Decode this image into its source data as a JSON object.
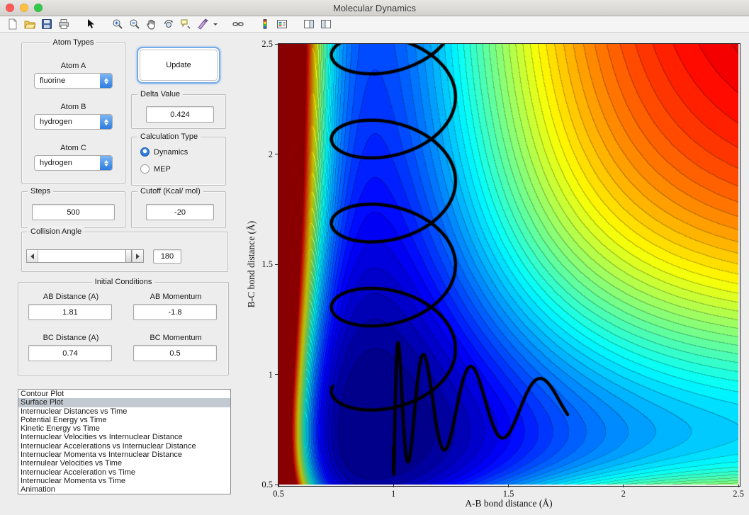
{
  "window": {
    "title": "Molecular Dynamics"
  },
  "colors": {
    "traffic_red": "#fc5b57",
    "traffic_yellow": "#fdbe41",
    "traffic_green": "#34c84a",
    "accent_blue": "#2e7ce0",
    "list_selection_bg": "#c2c9d1",
    "figure_bg": "#ededed"
  },
  "toolbar": {
    "groups": [
      [
        "new-figure",
        "open-file",
        "save-figure",
        "print-figure"
      ],
      [
        "edit-plot-pointer"
      ],
      [
        "zoom-in",
        "zoom-out",
        "pan",
        "rotate-3d",
        "data-cursor",
        "brush",
        "brush-dropdown"
      ],
      [
        "link-plot"
      ],
      [
        "insert-colorbar",
        "insert-legend"
      ],
      [
        "hide-plot-tools",
        "show-plot-tools"
      ]
    ]
  },
  "controls": {
    "atom_types": {
      "title": "Atom Types",
      "fields": [
        {
          "label": "Atom A",
          "value": "fluorine"
        },
        {
          "label": "Atom B",
          "value": "hydrogen"
        },
        {
          "label": "Atom C",
          "value": "hydrogen"
        }
      ]
    },
    "update_label": "Update",
    "delta": {
      "title": "Delta Value",
      "value": "0.424"
    },
    "calculation_type": {
      "title": "Calculation Type",
      "options": [
        {
          "label": "Dynamics",
          "selected": true
        },
        {
          "label": "MEP",
          "selected": false
        }
      ]
    },
    "steps": {
      "title": "Steps",
      "value": "500"
    },
    "cutoff": {
      "title": "Cutoff (Kcal/ mol)",
      "value": "-20"
    },
    "collision_angle": {
      "title": "Collision Angle",
      "value": "180"
    },
    "initial_conditions": {
      "title": "Initial Conditions",
      "fields": [
        {
          "label": "AB Distance (A)",
          "value": "1.81"
        },
        {
          "label": "AB Momentum",
          "value": "-1.8"
        },
        {
          "label": "BC Distance (A)",
          "value": "0.74"
        },
        {
          "label": "BC Momentum",
          "value": "0.5"
        }
      ]
    },
    "plot_list": {
      "selected_index": 1,
      "items": [
        "Contour Plot",
        "Surface Plot",
        "Internuclear Distances vs Time",
        "Potential Energy vs Time",
        "Kinetic Energy vs Time",
        "Internuclear Velocities vs Internuclear Distance",
        "Internuclear Accelerations vs Internuclear Distance",
        "Internuclear Momenta vs Internuclear Distance",
        "Internulear Velocities vs Time",
        "Internuclear Acceleration vs Time",
        "Internuclear Momenta vs Time",
        "Animation"
      ]
    }
  },
  "chart_data": {
    "type": "contour",
    "title": "",
    "xlabel": "A-B bond distance (Å)",
    "ylabel": "B-C bond distance (Å)",
    "xlim": [
      0.5,
      2.5
    ],
    "ylim": [
      0.5,
      2.5
    ],
    "xticks": [
      0.5,
      1,
      1.5,
      2,
      2.5
    ],
    "yticks": [
      2.5,
      2,
      1.5,
      1,
      0.5
    ],
    "xtick_labels": [
      "0.5",
      "1",
      "1.5",
      "2",
      "2.5"
    ],
    "ytick_labels": [
      "2.5",
      "2",
      "1.5",
      "1",
      "0.5"
    ],
    "grid": false,
    "legend": "none",
    "colormap": "jet",
    "levels": 48,
    "gamma": 1.8,
    "vmin": -245,
    "vmax": 0,
    "surface_model": {
      "description": "LEPS-like potential energy surface approximated as V(x,y)=Morse(x;AB)+Morse(y;BC), clipped to [vmin,vmax]; dark-red = repulsive walls, blue L-shaped valley along x≈0.92 (vertical arm) and y≈0.74 (horizontal arm)",
      "morse_AB": {
        "D": 140,
        "a": 2.3,
        "r0": 0.92
      },
      "morse_BC": {
        "D": 105,
        "a": 1.95,
        "r0": 0.74
      }
    },
    "trajectory": {
      "description": "black classical trajectory: oscillating descent down the vertical valley then vibrating exit along the horizontal valley toward larger A-B distance",
      "color": "#000000",
      "width": 4.5,
      "segments": [
        {
          "type": "descent",
          "t0": 0,
          "t1": 5.15,
          "dt": 0.008,
          "x_center": 1.0,
          "x_amp": 0.27,
          "omega": 5.6,
          "phase": 1.25,
          "y_start": 2.66,
          "y_drift": -0.34,
          "y_amp": 0.17
        },
        {
          "type": "exit",
          "t0": 0,
          "t1": 4.8,
          "dt": 0.008,
          "x_start": 1.0,
          "x_accel": 0.033,
          "y_center": 0.86,
          "y_amp0": 0.32,
          "y_amp_decay": -0.045,
          "omega": 5.2,
          "phase": 2.2
        }
      ]
    }
  }
}
